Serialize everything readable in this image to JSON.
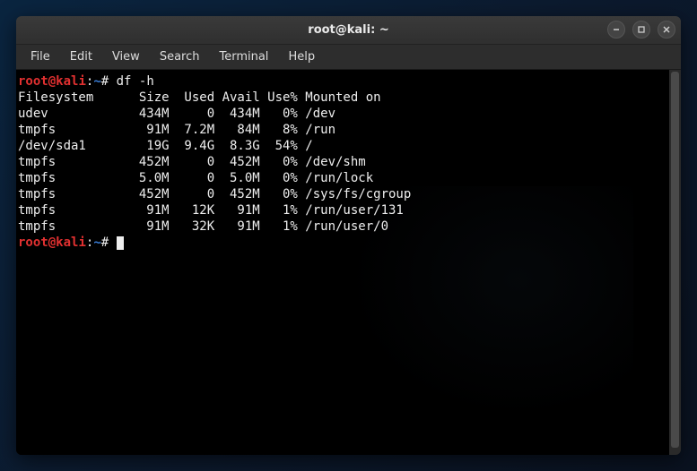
{
  "window": {
    "title": "root@kali: ~"
  },
  "menu": {
    "items": [
      "File",
      "Edit",
      "View",
      "Search",
      "Terminal",
      "Help"
    ]
  },
  "prompt": {
    "user": "root",
    "at": "@",
    "host": "kali",
    "sep1": ":",
    "path": "~",
    "sep2": "# "
  },
  "command1": "df -h",
  "df": {
    "header": "Filesystem      Size  Used Avail Use% Mounted on",
    "chart_data": {
      "type": "table",
      "columns": [
        "Filesystem",
        "Size",
        "Used",
        "Avail",
        "Use%",
        "Mounted on"
      ],
      "rows": [
        [
          "udev",
          "434M",
          "0",
          "434M",
          "0%",
          "/dev"
        ],
        [
          "tmpfs",
          "91M",
          "7.2M",
          "84M",
          "8%",
          "/run"
        ],
        [
          "/dev/sda1",
          "19G",
          "9.4G",
          "8.3G",
          "54%",
          "/"
        ],
        [
          "tmpfs",
          "452M",
          "0",
          "452M",
          "0%",
          "/dev/shm"
        ],
        [
          "tmpfs",
          "5.0M",
          "0",
          "5.0M",
          "0%",
          "/run/lock"
        ],
        [
          "tmpfs",
          "452M",
          "0",
          "452M",
          "0%",
          "/sys/fs/cgroup"
        ],
        [
          "tmpfs",
          "91M",
          "12K",
          "91M",
          "1%",
          "/run/user/131"
        ],
        [
          "tmpfs",
          "91M",
          "32K",
          "91M",
          "1%",
          "/run/user/0"
        ]
      ]
    }
  },
  "colors": {
    "prompt_user_host": "#e03030",
    "prompt_path": "#3a7ed8",
    "terminal_bg": "#000000",
    "terminal_fg": "#eeeeee"
  }
}
